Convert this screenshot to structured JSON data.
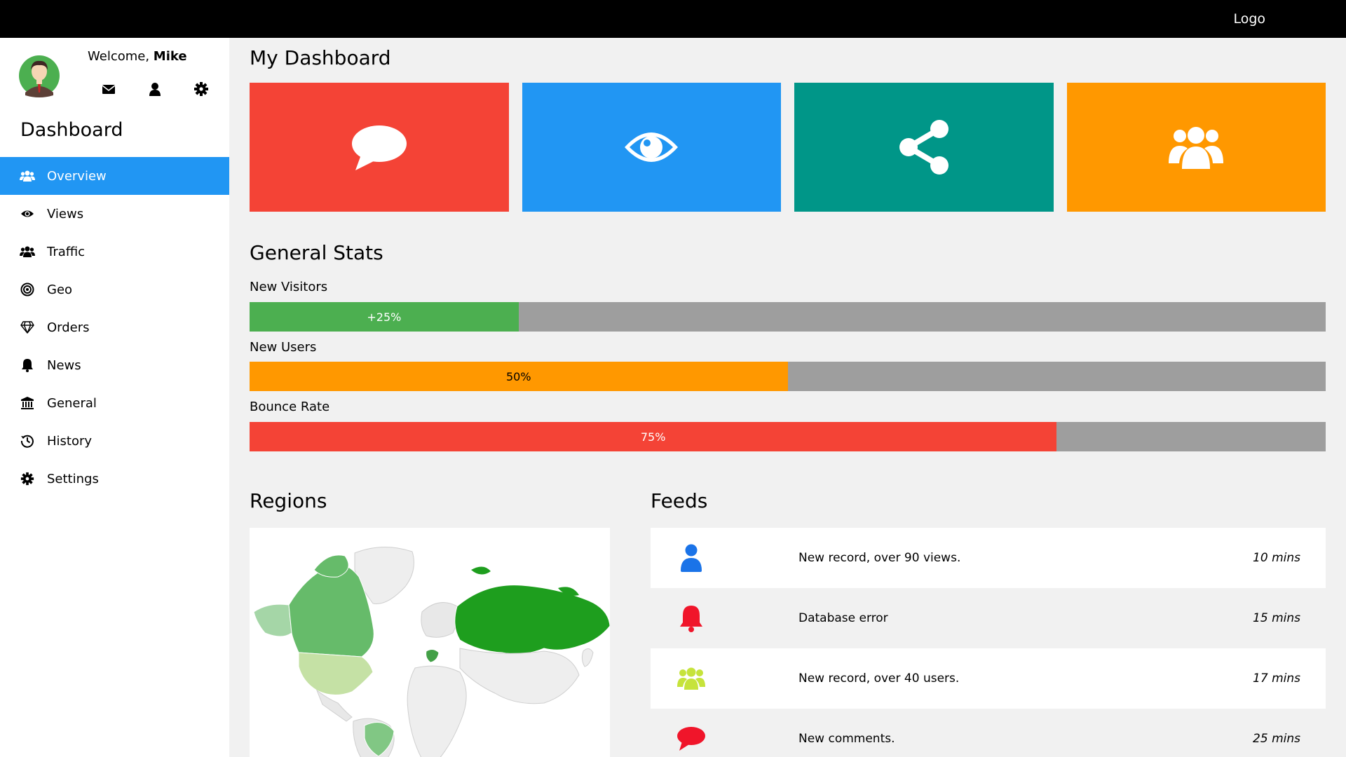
{
  "topbar": {
    "logo": "Logo"
  },
  "user": {
    "welcome_prefix": "Welcome,",
    "name": "Mike"
  },
  "sidebar": {
    "title": "Dashboard",
    "items": [
      {
        "label": "Overview",
        "icon": "users-icon"
      },
      {
        "label": "Views",
        "icon": "eye-icon"
      },
      {
        "label": "Traffic",
        "icon": "users-icon"
      },
      {
        "label": "Geo",
        "icon": "bullseye-icon"
      },
      {
        "label": "Orders",
        "icon": "diamond-icon"
      },
      {
        "label": "News",
        "icon": "bell-icon"
      },
      {
        "label": "General",
        "icon": "bank-icon"
      },
      {
        "label": "History",
        "icon": "history-icon"
      },
      {
        "label": "Settings",
        "icon": "cog-icon"
      }
    ]
  },
  "main": {
    "title": "My Dashboard",
    "tiles": [
      {
        "icon": "comment-icon",
        "color": "#f44336"
      },
      {
        "icon": "eye-icon",
        "color": "#2196f3"
      },
      {
        "icon": "share-icon",
        "color": "#009688"
      },
      {
        "icon": "users-icon",
        "color": "#ff9800"
      }
    ]
  },
  "stats": {
    "title": "General Stats",
    "items": [
      {
        "label": "New Visitors",
        "text": "+25%",
        "percent": 25,
        "color": "#4caf50",
        "text_color": "#ffffff"
      },
      {
        "label": "New Users",
        "text": "50%",
        "percent": 50,
        "color": "#ff9800",
        "text_color": "#000000"
      },
      {
        "label": "Bounce Rate",
        "text": "75%",
        "percent": 75,
        "color": "#f44336",
        "text_color": "#ffffff"
      }
    ]
  },
  "regions": {
    "title": "Regions"
  },
  "feeds": {
    "title": "Feeds",
    "items": [
      {
        "icon": "user-icon",
        "icon_color": "#2196f3",
        "text": "New record, over 90 views.",
        "time": "10 mins"
      },
      {
        "icon": "bell-icon",
        "icon_color": "#f44336",
        "text": "Database error",
        "time": "15 mins"
      },
      {
        "icon": "users-icon",
        "icon_color": "#cddc39",
        "text": "New record, over 40 users.",
        "time": "17 mins"
      },
      {
        "icon": "comment-icon",
        "icon_color": "#f44336",
        "text": "New comments.",
        "time": "25 mins"
      }
    ]
  }
}
